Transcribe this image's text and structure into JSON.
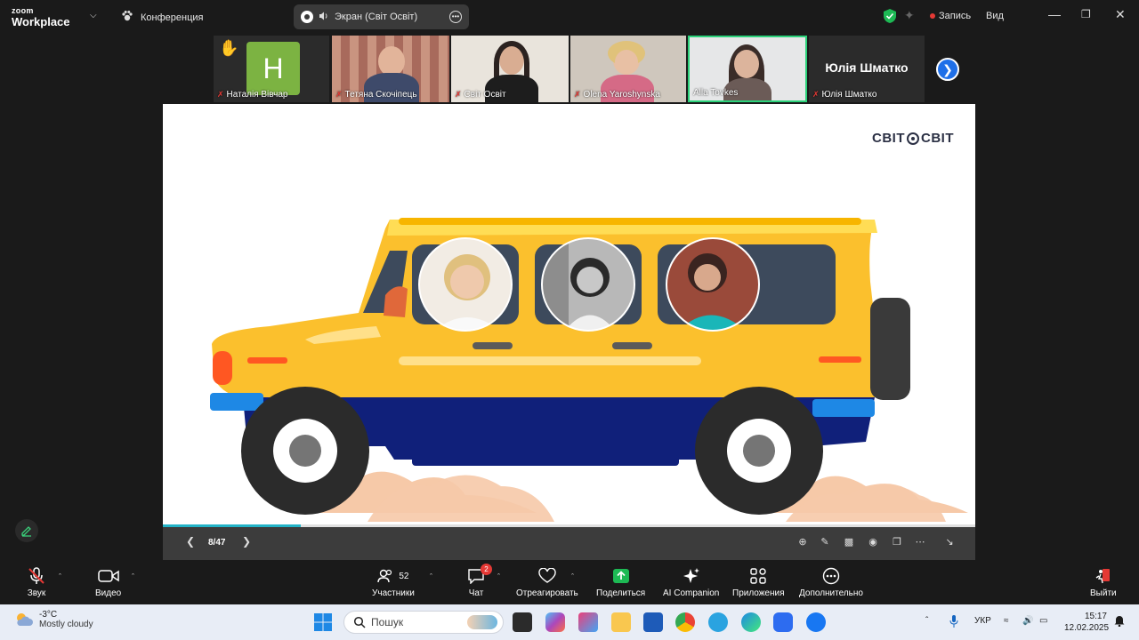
{
  "app": {
    "brand_small": "zoom",
    "brand_large": "Workplace",
    "meeting_title": "Конференция",
    "share_label": "Экран (Світ Освіт)",
    "record_label": "Запись",
    "view_label": "Вид"
  },
  "participants": [
    {
      "name": "Наталія Вівчар",
      "initial": "H",
      "hand_raised": true,
      "muted": true
    },
    {
      "name": "Тетяна Скочіпець",
      "muted": true
    },
    {
      "name": "Світ Освіт",
      "muted": true
    },
    {
      "name": "Olena Yaroshynska",
      "muted": true
    },
    {
      "name": "Alla Tovkes",
      "active_speaker": true,
      "muted": false
    },
    {
      "name": "Юлія Шматко",
      "display_text": "Юлія Шматко",
      "muted": true
    }
  ],
  "slide": {
    "logo_left": "СВІТ",
    "logo_right": "СВІТ",
    "page": "8/47",
    "progress_fraction": 0.17
  },
  "toolbar": {
    "audio": "Звук",
    "video": "Видео",
    "participants": "Участники",
    "participants_count": "52",
    "chat": "Чат",
    "chat_badge": "2",
    "react": "Отреагировать",
    "share": "Поделиться",
    "ai": "AI Companion",
    "apps": "Приложения",
    "more": "Дополнительно",
    "leave": "Выйти"
  },
  "taskbar": {
    "temperature": "-3°C",
    "weather": "Mostly cloudy",
    "search_placeholder": "Пошук",
    "language": "УКР",
    "time": "15:17",
    "date": "12.02.2025"
  },
  "colors": {
    "zoom_blue": "#1e6fe8",
    "share_green": "#1db954",
    "active_speaker": "#2bd27a",
    "mute_red": "#e53935",
    "car_yellow": "#fbc02d"
  }
}
